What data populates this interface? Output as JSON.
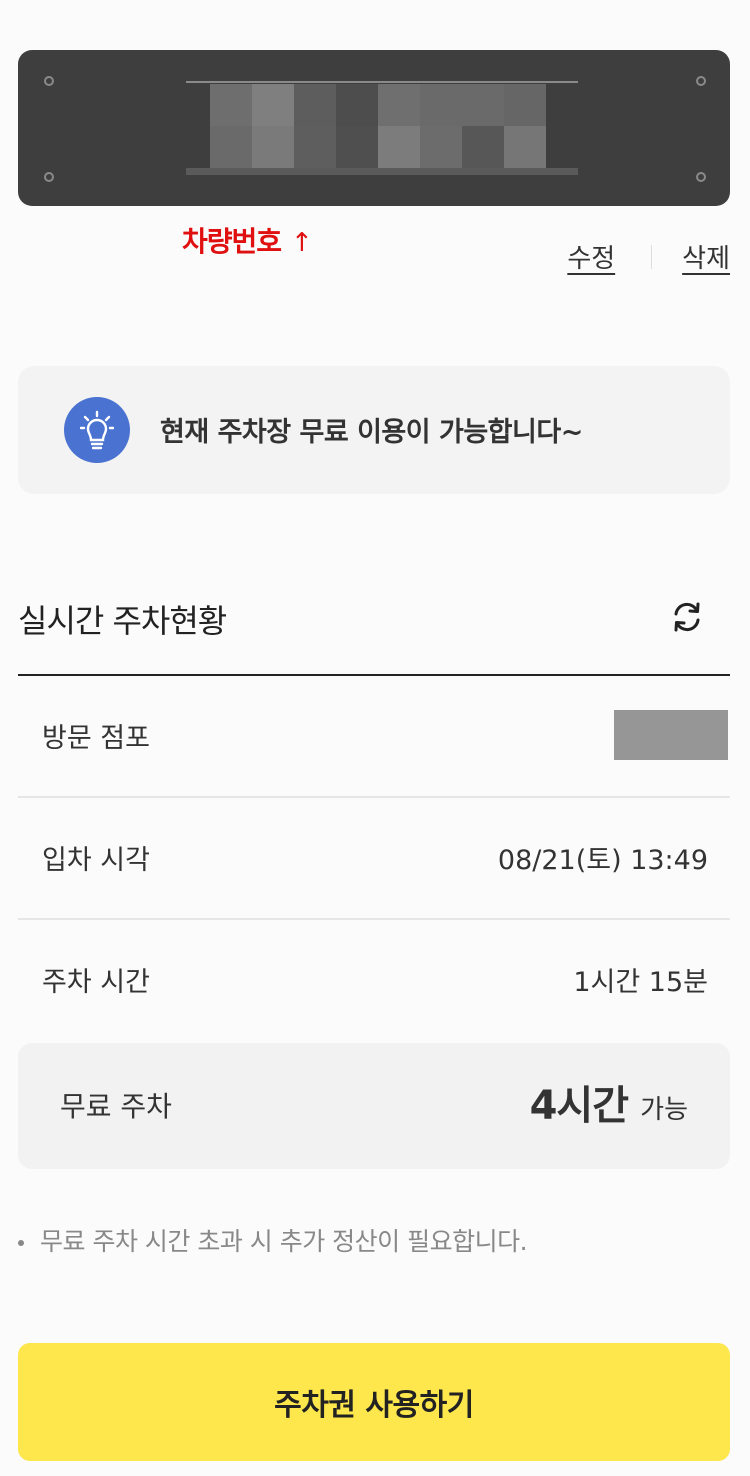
{
  "plate": {
    "caption": "차량번호",
    "caption_arrow": "↑",
    "mosaic_colors": [
      "#6e6e6e",
      "#7f7f7f",
      "#5d5d5d",
      "#4d4d4d",
      "#6f6f6f",
      "#6a6a6a",
      "#6a6a6a",
      "#666666",
      "#6a6a6a",
      "#7a7a7a",
      "#5e5e5e",
      "#4f4f4f",
      "#7c7c7c",
      "#6c6c6c",
      "#575757",
      "#767676"
    ]
  },
  "plate_actions": {
    "edit_label": "수정",
    "delete_label": "삭제"
  },
  "notice": {
    "icon": "lightbulb-icon",
    "message": "현재 주차장 무료 이용이 가능합니다~"
  },
  "status": {
    "title": "실시간 주차현황",
    "refresh_icon": "refresh-icon",
    "rows": [
      {
        "label": "방문 점포",
        "value": ""
      },
      {
        "label": "입차 시각",
        "value": "08/21(토) 13:49"
      },
      {
        "label": "주차 시간",
        "value": "1시간 15분"
      }
    ]
  },
  "free_parking": {
    "label": "무료 주차",
    "hours": "4시간",
    "suffix": "가능"
  },
  "note": "무료 주차 시간 초과 시 추가 정산이 필요합니다.",
  "cta_label": "주차권 사용하기",
  "colors": {
    "accent_yellow": "#fde74c",
    "bulb_blue": "#4a72d1",
    "caption_red": "#e01010"
  }
}
